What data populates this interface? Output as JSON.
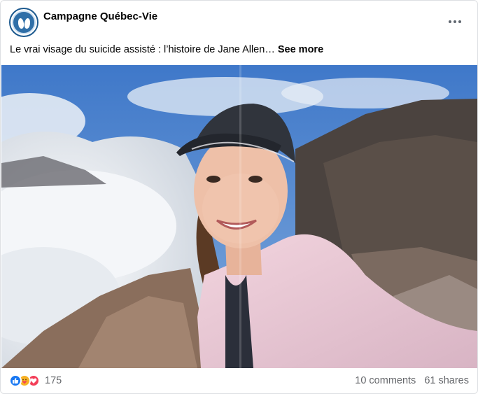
{
  "post": {
    "author": "Campagne Québec-Vie",
    "caption": "Le vrai visage du suicide assisté : l’histoire de Jane Allen…",
    "see_more": "See more",
    "reactions_count": "175",
    "comments": "10 comments",
    "shares": "61 shares",
    "reaction_icons": [
      "like-icon",
      "care-icon",
      "love-icon"
    ],
    "accent_color": "#1877f2"
  }
}
